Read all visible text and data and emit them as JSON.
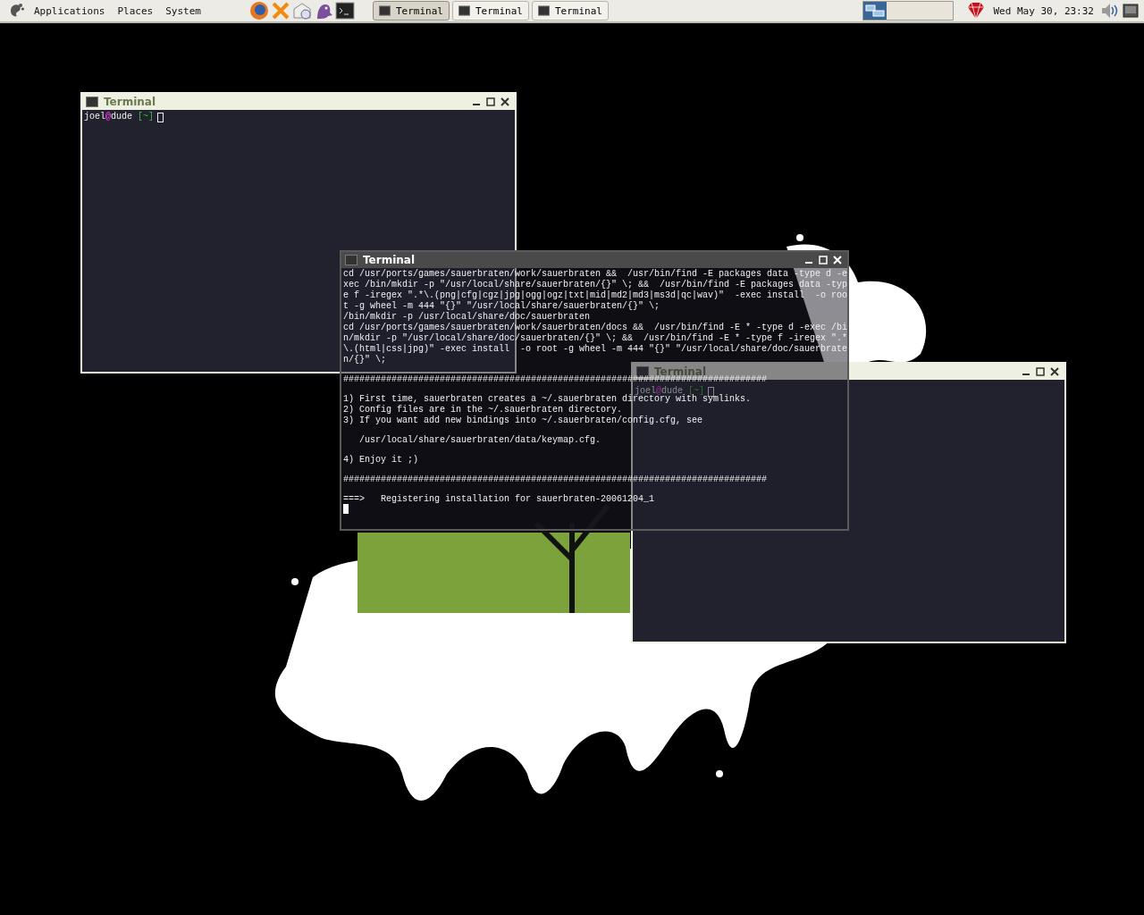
{
  "panel": {
    "menus": [
      "Applications",
      "Places",
      "System"
    ],
    "tasks": [
      {
        "label": "Terminal",
        "selected": true
      },
      {
        "label": "Terminal",
        "selected": false
      },
      {
        "label": "Terminal",
        "selected": false
      }
    ],
    "clock": "Wed May 30, 23:32"
  },
  "windows": [
    {
      "title": "Terminal",
      "active": false,
      "prompt": {
        "user": "joel",
        "at": "@",
        "host": "dude",
        "dir": "[~]"
      }
    },
    {
      "title": "Terminal",
      "active": false,
      "prompt": {
        "user": "joel",
        "at": "@",
        "host": "dude",
        "dir": "[~]"
      }
    },
    {
      "title": "Terminal",
      "active": true,
      "paragraphs": [
        [
          "cd /usr/ports/games/sauerbraten/work/sauerbraten &&  /usr/bin/find -E packages data -type d -e",
          "xec /bin/mkdir -p \"/usr/local/share/sauerbraten/{}\" \\; &&  /usr/bin/find -E packages data -typ",
          "e f -iregex \".*\\.(png|cfg|cgz|jpg|ogg|ogz|txt|mid|md2|md3|ms3d|qc|wav)\"  -exec install  -o roo",
          "t -g wheel -m 444 \"{}\" \"/usr/local/share/sauerbraten/{}\" \\;",
          "/bin/mkdir -p /usr/local/share/doc/sauerbraten",
          "cd /usr/ports/games/sauerbraten/work/sauerbraten/docs &&  /usr/bin/find -E * -type d -exec /bi",
          "n/mkdir -p \"/usr/local/share/doc/sauerbraten/{}\" \\; &&  /usr/bin/find -E * -type f -iregex \".*",
          "\\.(html|css|jpg)\" -exec install  -o root -g wheel -m 444 \"{}\" \"/usr/local/share/doc/sauerbrate",
          "n/{}\" \\;"
        ],
        [
          "###############################################################################"
        ],
        [
          "1) First time, sauerbraten creates a ~/.sauerbraten directory with symlinks.",
          "2) Config files are in the ~/.sauerbraten directory.",
          "3) If you want add new bindings into ~/.sauerbraten/config.cfg, see"
        ],
        [
          "   /usr/local/share/sauerbraten/data/keymap.cfg."
        ],
        [
          "4) Enjoy it ;)"
        ],
        [
          "###############################################################################"
        ],
        [
          "===>   Registering installation for sauerbraten-20061204_1"
        ]
      ]
    }
  ]
}
